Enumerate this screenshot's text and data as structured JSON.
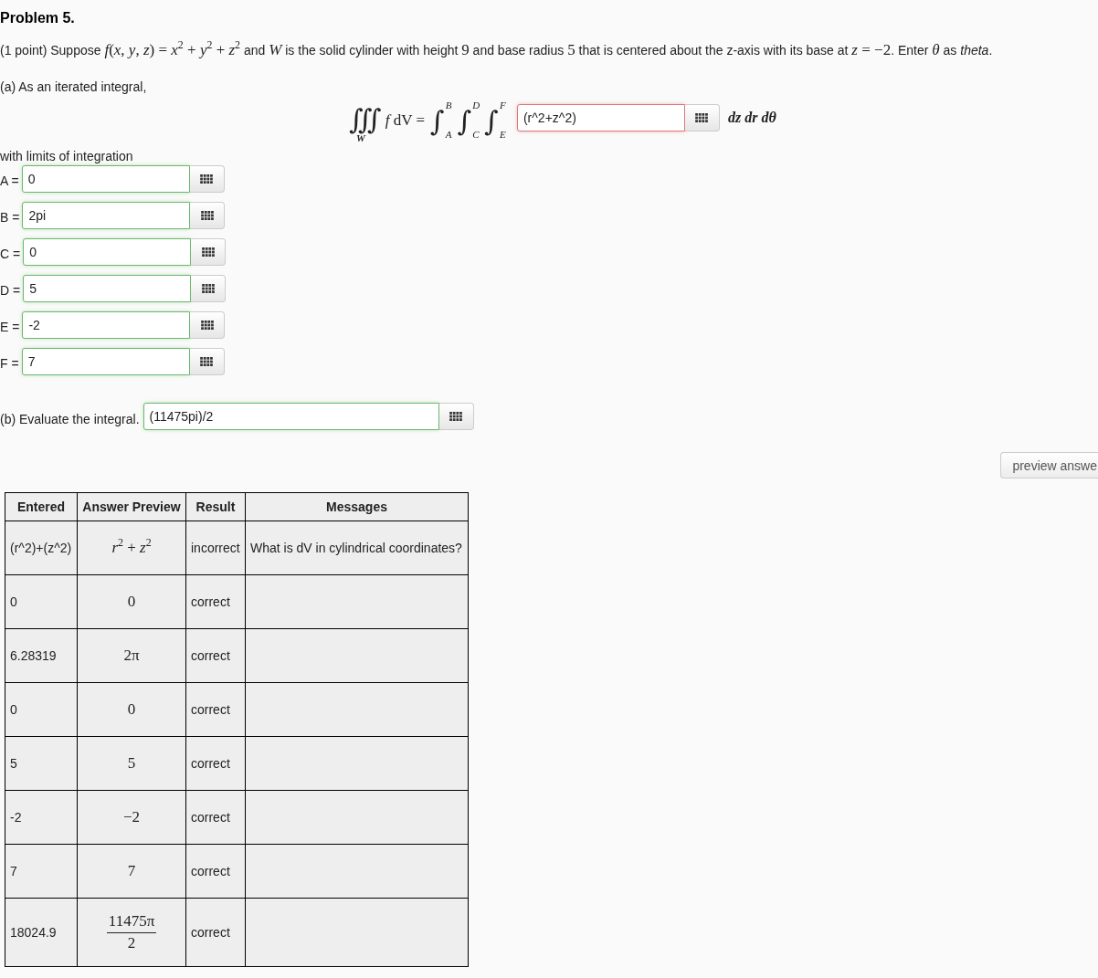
{
  "problem": {
    "title": "Problem 5.",
    "statement": [
      {
        "kind": "text",
        "text": "(1 point) Suppose "
      },
      {
        "kind": "math",
        "text": "*f*(*x*, *y*, *z*) = *x*$^{2}$ + *y*$^{2}$ + *z*$^{2}$"
      },
      {
        "kind": "text",
        "text": " and "
      },
      {
        "kind": "math",
        "text": "*W*"
      },
      {
        "kind": "text",
        "text": " is the solid cylinder with height "
      },
      {
        "kind": "math",
        "text": "9"
      },
      {
        "kind": "text",
        "text": " and base radius "
      },
      {
        "kind": "math",
        "text": "5"
      },
      {
        "kind": "text",
        "text": " that is centered about the z-axis with its base at "
      },
      {
        "kind": "math",
        "text": "*z* = −2"
      },
      {
        "kind": "text",
        "text": ". Enter "
      },
      {
        "kind": "math",
        "text": "*θ*"
      },
      {
        "kind": "text",
        "text": " as *theta*."
      }
    ]
  },
  "part_a": {
    "label": "(a) As an iterated integral,",
    "integral": {
      "outer_sign": "∭",
      "region": "W",
      "integrand": "*f* dV =",
      "integrals": [
        {
          "sign": "∫",
          "lower": "A",
          "upper": "B"
        },
        {
          "sign": "∫",
          "lower": "C",
          "upper": "D"
        },
        {
          "sign": "∫",
          "lower": "E",
          "upper": "F"
        }
      ],
      "answer": {
        "value": "(r^2+z^2)",
        "correct": false
      },
      "differentials": "dz dr dθ"
    },
    "limits_label": "with limits of integration",
    "limits": [
      {
        "label": "A =",
        "value": "0",
        "correct": true
      },
      {
        "label": "B =",
        "value": "2pi",
        "correct": true
      },
      {
        "label": "C =",
        "value": "0",
        "correct": true
      },
      {
        "label": "D =",
        "value": "5",
        "correct": true
      },
      {
        "label": "E =",
        "value": "-2",
        "correct": true
      },
      {
        "label": "F =",
        "value": "7",
        "correct": true
      }
    ]
  },
  "part_b": {
    "label": "(b) Evaluate the integral.",
    "answer": {
      "value": "(11475pi)/2",
      "correct": true
    }
  },
  "preview_button": {
    "label": "preview answe"
  },
  "results_table": {
    "columns": [
      "Entered",
      "Answer Preview",
      "Result",
      "Messages"
    ],
    "rows": [
      {
        "entered": "(r^2)+(z^2)",
        "preview": {
          "kind": "math",
          "text": "*r*$^{2}$ + *z*$^{2}$"
        },
        "result": "incorrect",
        "message": "What is dV in cylindrical coordinates?"
      },
      {
        "entered": "0",
        "preview": {
          "kind": "math",
          "text": "0"
        },
        "result": "correct"
      },
      {
        "entered": "6.28319",
        "preview": {
          "kind": "math",
          "text": "2π"
        },
        "result": "correct"
      },
      {
        "entered": "0",
        "preview": {
          "kind": "math",
          "text": "0"
        },
        "result": "correct"
      },
      {
        "entered": "5",
        "preview": {
          "kind": "math",
          "text": "5"
        },
        "result": "correct"
      },
      {
        "entered": "-2",
        "preview": {
          "kind": "math",
          "text": "−2"
        },
        "result": "correct"
      },
      {
        "entered": "7",
        "preview": {
          "kind": "math",
          "text": "7"
        },
        "result": "correct"
      },
      {
        "entered": "18024.9",
        "preview": {
          "kind": "fraction",
          "numerator": "11475π",
          "denominator": "2"
        },
        "result": "correct"
      }
    ]
  }
}
